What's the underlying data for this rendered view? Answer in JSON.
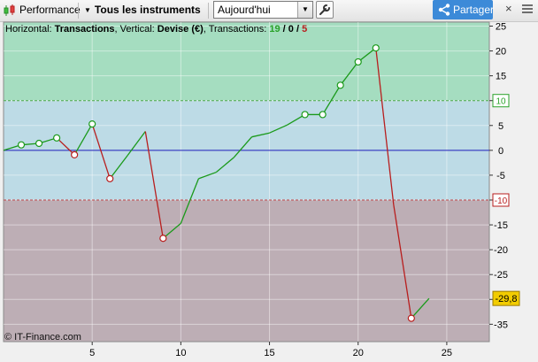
{
  "toolbar": {
    "performance_label": "Performance",
    "instruments_label": "Tous les instruments",
    "period_value": "Aujourd'hui",
    "share_label": "Partager",
    "close_glyph": "×"
  },
  "chart_header": {
    "prefix": "Horizontal: ",
    "h_axis": "Transactions",
    "mid": ", Vertical: ",
    "v_axis": "Devise (€)",
    "count_prefix": ", Transactions: ",
    "wins": "19",
    "sep1": " / ",
    "neutral": "0",
    "sep2": " / ",
    "losses": "5"
  },
  "watermark": "© IT-Finance.com",
  "colors": {
    "zone_top": "#a5ddc0",
    "zone_mid": "#bddbe6",
    "zone_bottom": "#bdaeb5",
    "win_line": "#1a9a1a",
    "loss_line": "#b81e1e",
    "zero_line": "#1a1ab8",
    "current_badge": "#f2cc00",
    "label_win": "#2aa22a",
    "label_loss": "#b81e1e"
  },
  "chart_data": {
    "type": "line",
    "xlabel": "Transactions",
    "ylabel": "Devise (€)",
    "xlim": [
      0,
      27.4
    ],
    "ylim": [
      -38.5,
      25.8
    ],
    "x_ticks": [
      5,
      10,
      15,
      20,
      25
    ],
    "y_ticks": [
      25,
      20,
      15,
      10,
      5,
      0,
      -5,
      -10,
      -15,
      -20,
      -25,
      -30,
      -35
    ],
    "thresholds": {
      "upper": 10,
      "lower": -10,
      "upper_label": "10",
      "lower_label": "-10"
    },
    "current_value_label": "-29,8",
    "x": [
      0,
      1,
      2,
      3,
      4,
      5,
      6,
      7,
      8,
      9,
      10,
      11,
      12,
      13,
      14,
      15,
      16,
      17,
      18,
      19,
      20,
      21,
      22,
      23,
      24
    ],
    "y": [
      0,
      1.1,
      1.4,
      2.5,
      -0.9,
      5.3,
      -5.7,
      -1.0,
      3.8,
      -17.7,
      -14.7,
      -5.7,
      -4.4,
      -1.4,
      2.7,
      3.5,
      5.1,
      7.2,
      7.2,
      13.1,
      17.8,
      20.6,
      -10.9,
      -33.8,
      -29.8
    ],
    "markers": [
      {
        "x": 1,
        "y": 1.1,
        "kind": "win"
      },
      {
        "x": 2,
        "y": 1.4,
        "kind": "win"
      },
      {
        "x": 3,
        "y": 2.5,
        "kind": "win"
      },
      {
        "x": 4,
        "y": -0.9,
        "kind": "loss"
      },
      {
        "x": 5,
        "y": 5.3,
        "kind": "win"
      },
      {
        "x": 6,
        "y": -5.7,
        "kind": "loss"
      },
      {
        "x": 9,
        "y": -17.7,
        "kind": "loss"
      },
      {
        "x": 17,
        "y": 7.2,
        "kind": "win"
      },
      {
        "x": 18,
        "y": 7.2,
        "kind": "win"
      },
      {
        "x": 19,
        "y": 13.1,
        "kind": "win"
      },
      {
        "x": 20,
        "y": 17.8,
        "kind": "win"
      },
      {
        "x": 21,
        "y": 20.6,
        "kind": "win"
      },
      {
        "x": 23,
        "y": -33.8,
        "kind": "loss"
      }
    ]
  }
}
